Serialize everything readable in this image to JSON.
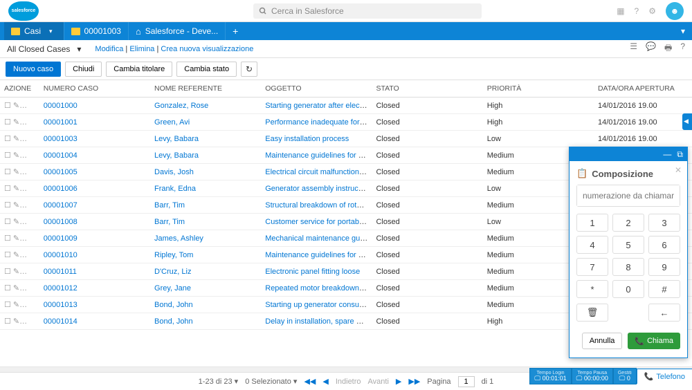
{
  "app": {
    "name": "salesforce",
    "search_placeholder": "Cerca in Salesforce"
  },
  "tabs": {
    "casi": "Casi",
    "caseNumber": "00001003",
    "devTab": "Salesforce - Deve..."
  },
  "filter": {
    "view": "All Closed Cases",
    "modify": "Modifica",
    "delete": "Elimina",
    "newview": "Crea nuova visualizzazione"
  },
  "buttons": {
    "new": "Nuovo caso",
    "close": "Chiudi",
    "owner": "Cambia titolare",
    "status": "Cambia stato"
  },
  "columns": {
    "action": "AZIONE",
    "caseno": "NUMERO CASO",
    "contact": "NOME REFERENTE",
    "subject": "OGGETTO",
    "status": "STATO",
    "priority": "PRIORITÀ",
    "opened": "DATA/ORA APERTURA"
  },
  "rows": [
    {
      "no": "00001000",
      "contact": "Gonzalez, Rose",
      "subject": "Starting generator after electrical failure",
      "status": "Closed",
      "priority": "High",
      "opened": "14/01/2016 19.00"
    },
    {
      "no": "00001001",
      "contact": "Green, Avi",
      "subject": "Performance inadequate for second con...",
      "status": "Closed",
      "priority": "High",
      "opened": "14/01/2016 19.00"
    },
    {
      "no": "00001003",
      "contact": "Levy, Babara",
      "subject": "Easy installation process",
      "status": "Closed",
      "priority": "Low",
      "opened": "14/01/2016 19.00"
    },
    {
      "no": "00001004",
      "contact": "Levy, Babara",
      "subject": "Maintenance guidelines for generator un...",
      "status": "Closed",
      "priority": "Medium",
      "opened": ""
    },
    {
      "no": "00001005",
      "contact": "Davis, Josh",
      "subject": "Electrical circuit malfunctioning",
      "status": "Closed",
      "priority": "Medium",
      "opened": ""
    },
    {
      "no": "00001006",
      "contact": "Frank, Edna",
      "subject": "Generator assembly instructions unclear",
      "status": "Closed",
      "priority": "Low",
      "opened": ""
    },
    {
      "no": "00001007",
      "contact": "Barr, Tim",
      "subject": "Structural breakdown of rotor assembly",
      "status": "Closed",
      "priority": "Medium",
      "opened": ""
    },
    {
      "no": "00001008",
      "contact": "Barr, Tim",
      "subject": "Customer service for portable generators...",
      "status": "Closed",
      "priority": "Low",
      "opened": ""
    },
    {
      "no": "00001009",
      "contact": "James, Ashley",
      "subject": "Mechanical maintenance guidelines for g...",
      "status": "Closed",
      "priority": "Medium",
      "opened": ""
    },
    {
      "no": "00001010",
      "contact": "Ripley, Tom",
      "subject": "Maintenance guidelines for generator un...",
      "status": "Closed",
      "priority": "Medium",
      "opened": ""
    },
    {
      "no": "00001011",
      "contact": "D'Cruz, Liz",
      "subject": "Electronic panel fitting loose",
      "status": "Closed",
      "priority": "Medium",
      "opened": ""
    },
    {
      "no": "00001012",
      "contact": "Grey, Jane",
      "subject": "Repeated motor breakdown while shutti...",
      "status": "Closed",
      "priority": "Medium",
      "opened": ""
    },
    {
      "no": "00001013",
      "contact": "Bond, John",
      "subject": "Starting up generator consumes excessiv...",
      "status": "Closed",
      "priority": "Medium",
      "opened": ""
    },
    {
      "no": "00001014",
      "contact": "Bond, John",
      "subject": "Delay in installation, spare parts unavaila...",
      "status": "Closed",
      "priority": "High",
      "opened": ""
    }
  ],
  "pager": {
    "range": "1-23 di 23",
    "selected": "0 Selezionato",
    "back": "Indietro",
    "forward": "Avanti",
    "page_lbl": "Pagina",
    "page_val": "1",
    "page_of": "di 1"
  },
  "phone": {
    "title": "Composizione",
    "placeholder": "numerazione da chiamare",
    "keys": [
      "1",
      "2",
      "3",
      "4",
      "5",
      "6",
      "7",
      "8",
      "9",
      "*",
      "0",
      "#"
    ],
    "trash": "🗑",
    "back": "←",
    "cancel": "Annulla",
    "call": "Chiama",
    "bar1_lbl": "Tempo Login",
    "bar1_val": "00:01:01",
    "bar2_lbl": "Tempo Pausa",
    "bar2_val": "00:00:00",
    "bar3_lbl": "Gestiti",
    "bar3_val": "0",
    "toggle": "Telefono"
  }
}
